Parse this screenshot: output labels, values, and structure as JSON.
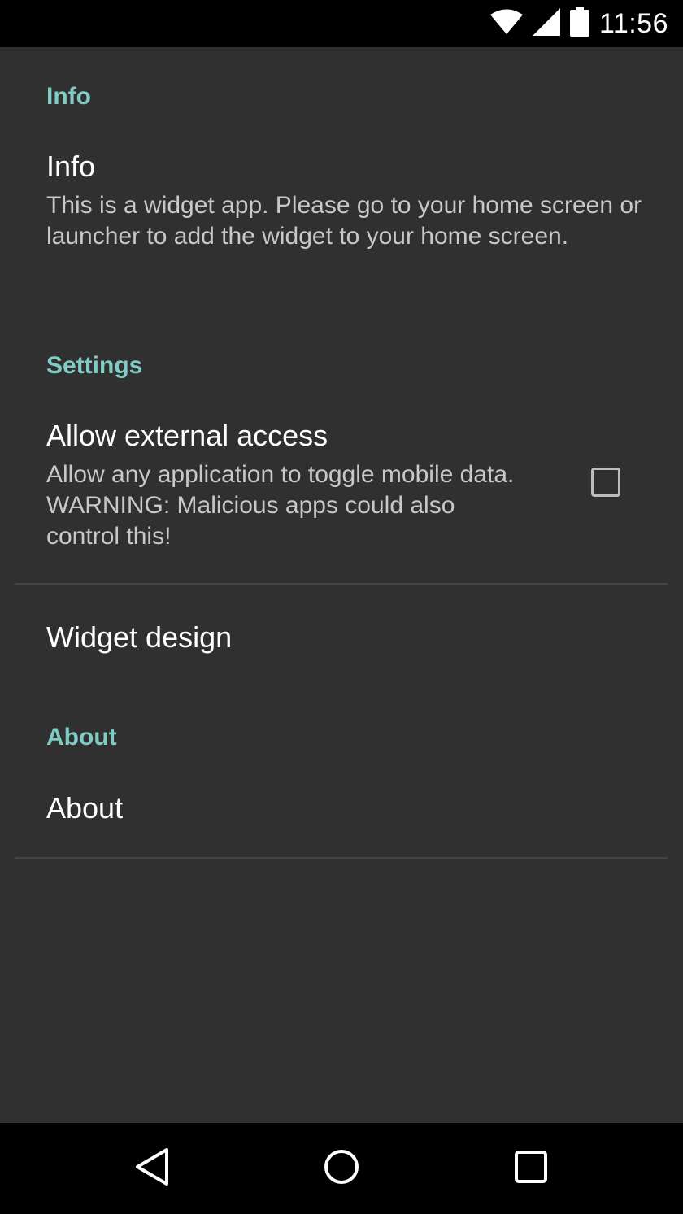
{
  "status_bar": {
    "time": "11:56",
    "icons": [
      "wifi-icon",
      "cell-signal-icon",
      "battery-icon"
    ]
  },
  "sections": {
    "info": {
      "header": "Info",
      "item_title": "Info",
      "item_summary": "This is a widget app. Please go to your home screen or launcher to add the widget to your home screen."
    },
    "settings": {
      "header": "Settings",
      "external_access_title": "Allow external access",
      "external_access_summary": "Allow any application to toggle mobile data. WARNING: Malicious apps could also control this!",
      "external_access_checked": false,
      "widget_design_title": "Widget design"
    },
    "about": {
      "header": "About",
      "item_title": "About"
    }
  },
  "nav_bar": {
    "buttons": [
      "back-icon",
      "home-icon",
      "recents-icon"
    ]
  },
  "colors": {
    "background": "#303030",
    "accent": "#80cbc4",
    "bars": "#000000"
  }
}
